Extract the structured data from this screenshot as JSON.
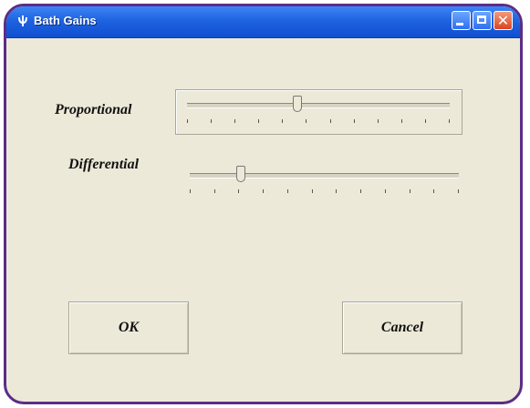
{
  "window": {
    "title": "Bath Gains",
    "app_icon": "psi-icon",
    "controls": [
      "minimize-icon",
      "maximize-icon",
      "close-icon"
    ],
    "close_glyph": "✕",
    "frame_color": "#5b2d86",
    "titlebar_color": "#1f63e0",
    "body_color": "#ece9d8"
  },
  "controls": {
    "proportional": {
      "label": "Proportional",
      "value_fraction": 0.42,
      "tick_count": 12
    },
    "differential": {
      "label": "Differential",
      "value_fraction": 0.19,
      "tick_count": 12
    }
  },
  "buttons": {
    "ok_label": "OK",
    "cancel_label": "Cancel"
  }
}
